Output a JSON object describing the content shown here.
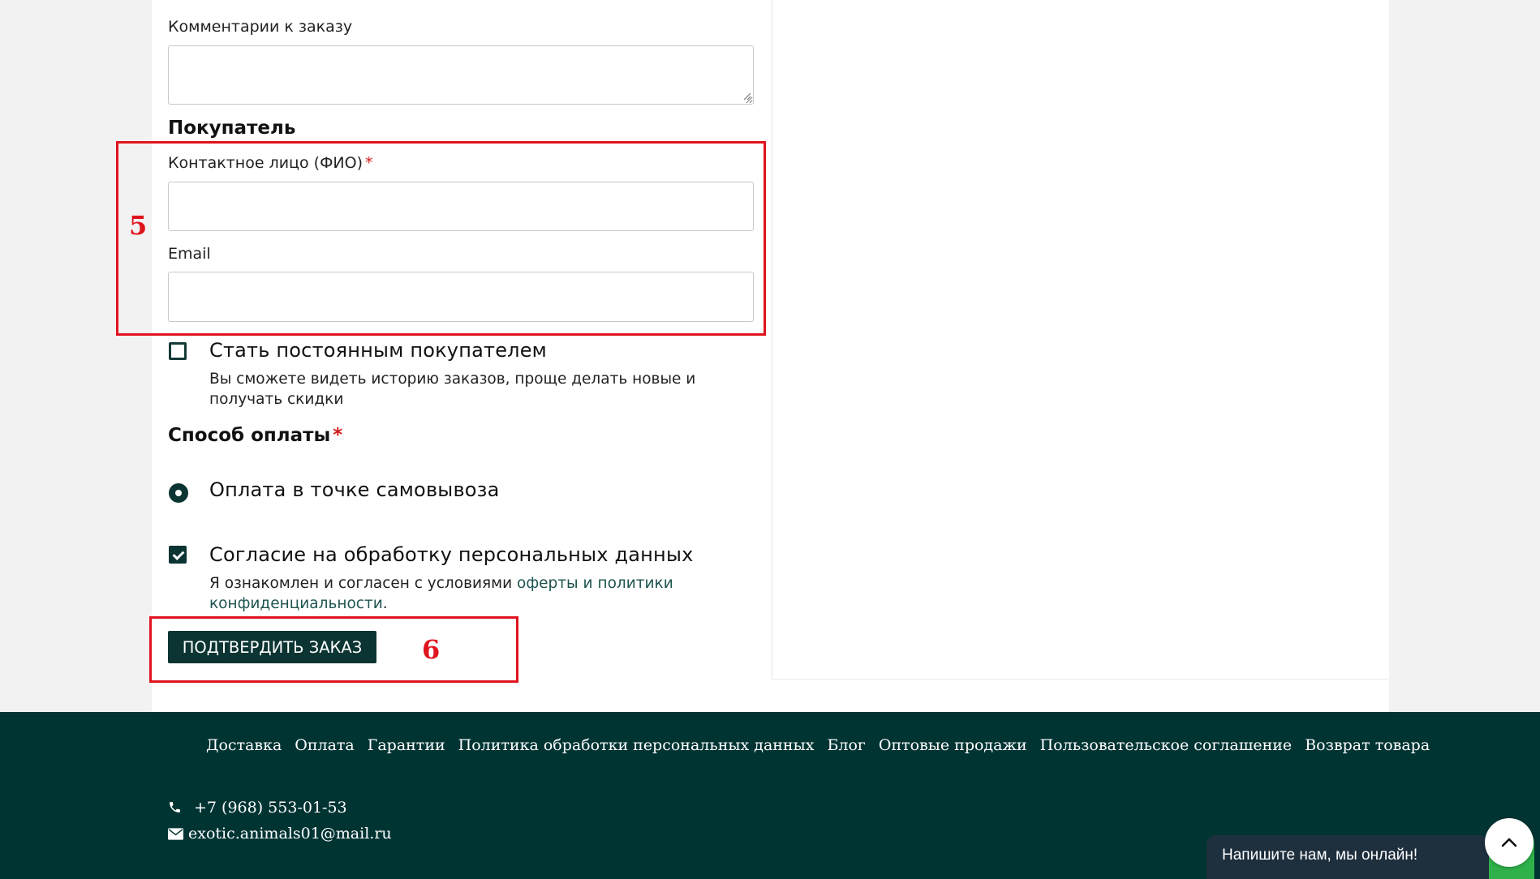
{
  "order_comment": {
    "label": "Комментарии к заказу",
    "value": ""
  },
  "buyer": {
    "section_title": "Покупатель",
    "contact_label": "Контактное лицо (ФИО)",
    "contact_required": "*",
    "contact_value": "",
    "email_label": "Email",
    "email_value": ""
  },
  "regular_customer": {
    "title": "Стать постоянным покупателем",
    "description": "Вы сможете видеть историю заказов, проще делать новые и получать скидки",
    "checked": false
  },
  "payment": {
    "section_title": "Способ оплаты",
    "required": "*",
    "option": "Оплата в точке самовывоза",
    "selected": true
  },
  "consent": {
    "title": "Согласие на обработку персональных данных",
    "text_before": "Я ознакомлен и согласен с условиями",
    "link_offer": "оферты",
    "text_and": "и",
    "link_policy": "политики конфиденциальности",
    "text_end": ".",
    "checked": true
  },
  "submit_label": "ПОДТВЕРДИТЬ ЗАКАЗ",
  "annotations": {
    "box5": "5",
    "box6": "6"
  },
  "footer": {
    "nav": [
      "Доставка",
      "Оплата",
      "Гарантии",
      "Политика обработки персональных данных",
      "Блог",
      "Оптовые продажи",
      "Пользовательское соглашение",
      "Возврат товара"
    ],
    "phone": "+7 (968) 553-01-53",
    "email": "exotic.animals01@mail.ru"
  },
  "chat_widget": {
    "label": "Напишите нам, мы онлайн!"
  },
  "colors": {
    "brand_dark": "#003433",
    "button": "#0b3432",
    "annotation": "#e0141e",
    "required": "#d21c1c"
  },
  "icons": [
    "phone-icon",
    "envelope-icon",
    "chevron-up-icon",
    "checkmark-icon",
    "resize-grip-icon"
  ]
}
